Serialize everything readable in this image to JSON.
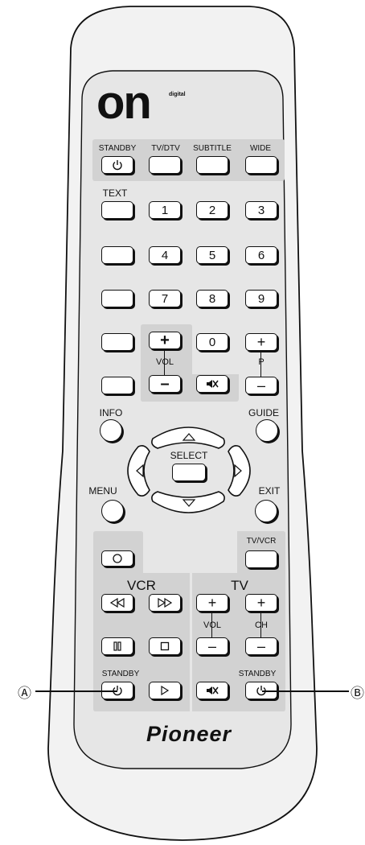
{
  "logo": {
    "text": "on",
    "superscript": "digital"
  },
  "top_row": {
    "labels": [
      "STANDBY",
      "TV/DTV",
      "SUBTITLE",
      "WIDE"
    ]
  },
  "text_label": "TEXT",
  "digits": [
    "1",
    "2",
    "3",
    "4",
    "5",
    "6",
    "7",
    "8",
    "9",
    "0"
  ],
  "vol_panel": {
    "plus": "+",
    "label": "VOL",
    "minus": "–",
    "mute_icon": "speaker-mute-icon"
  },
  "p_block": {
    "plus": "+",
    "label": "P",
    "minus": "–"
  },
  "nav": {
    "info": "INFO",
    "guide": "GUIDE",
    "select": "SELECT",
    "menu": "MENU",
    "exit": "EXIT"
  },
  "vcr": {
    "title": "VCR",
    "standby": "STANDBY"
  },
  "tv": {
    "tvvcr": "TV/VCR",
    "title": "TV",
    "vol": "VOL",
    "ch": "CH",
    "standby": "STANDBY",
    "plus": "+",
    "minus": "–"
  },
  "brand": "Pioneer",
  "callouts": {
    "a": "Ⓐ",
    "b": "Ⓑ"
  },
  "colors": {
    "body": "#e9e9e9",
    "panel": "#d2d2d2",
    "outline": "#111111"
  }
}
